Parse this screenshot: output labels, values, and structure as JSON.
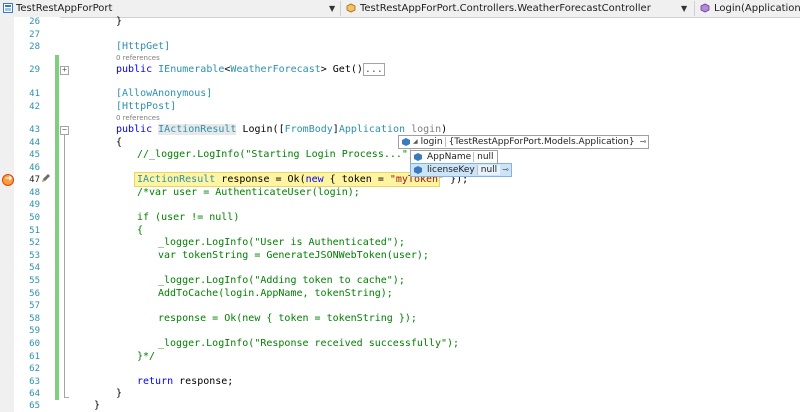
{
  "nav": {
    "project": "TestRestAppForPort",
    "class": "TestRestAppForPort.Controllers.WeatherForecastController",
    "member": "Login(Application log"
  },
  "line_numbers": [
    "26",
    "27",
    "28",
    "29",
    "41",
    "42",
    "43",
    "44",
    "45",
    "46",
    "47",
    "48",
    "49",
    "50",
    "51",
    "52",
    "53",
    "54",
    "55",
    "56",
    "57",
    "58",
    "59",
    "60",
    "61",
    "62",
    "63",
    "64",
    "65"
  ],
  "codelens": {
    "get": "0 references",
    "post": "0 references"
  },
  "code": {
    "l26": "}",
    "l28_attr": "[HttpGet]",
    "l29_kw": "public ",
    "l29_type": "IEnumerable",
    "l29_lt": "<",
    "l29_type2": "WeatherForecast",
    "l29_rest": "> Get()",
    "l29_collapsed": "...",
    "l41": "[AllowAnonymous]",
    "l42": "[HttpPost]",
    "l43_kw": "public ",
    "l43_type": "IActionResult",
    "l43_mid": " Login([",
    "l43_attr": "FromBody",
    "l43_mid2": "]",
    "l43_type2": "Application",
    "l43_param": " login",
    "l43_end": ")",
    "l44": "{",
    "l45": "//_logger.LogInfo(\"Starting Login Process...\");",
    "l47_type": "IActionResult",
    "l47_mid": " response = Ok(",
    "l47_kw": "new",
    "l47_mid2": " { token = ",
    "l47_str": "\"myToken\"",
    "l47_end": " });",
    "l48": "/*var user = AuthenticateUser(login);",
    "l50": "if (user != null)",
    "l51": "{",
    "l52": "_logger.LogInfo(\"User is Authenticated\");",
    "l53": "var tokenString = GenerateJSONWebToken(user);",
    "l55": "_logger.LogInfo(\"Adding token to cache\");",
    "l56": "AddToCache(login.AppName, tokenString);",
    "l58": "response = Ok(new { token = tokenString });",
    "l60": "_logger.LogInfo(\"Response received successfully\");",
    "l61": "}*/",
    "l63_kw": "return",
    "l63_rest": " response;",
    "l64": "}",
    "l65": "}"
  },
  "datatip": {
    "header_name": "login",
    "header_value": "{TestRestAppForPort.Models.Application}",
    "rows": [
      {
        "name": "AppName",
        "value": "null"
      },
      {
        "name": "licenseKey",
        "value": "null"
      }
    ]
  },
  "colors": {
    "keyword": "#0000ff",
    "type": "#2b91af",
    "string": "#a31515",
    "comment": "#008000",
    "exec_highlight": "#fff4a0",
    "change_bar": "#7ed07e"
  }
}
